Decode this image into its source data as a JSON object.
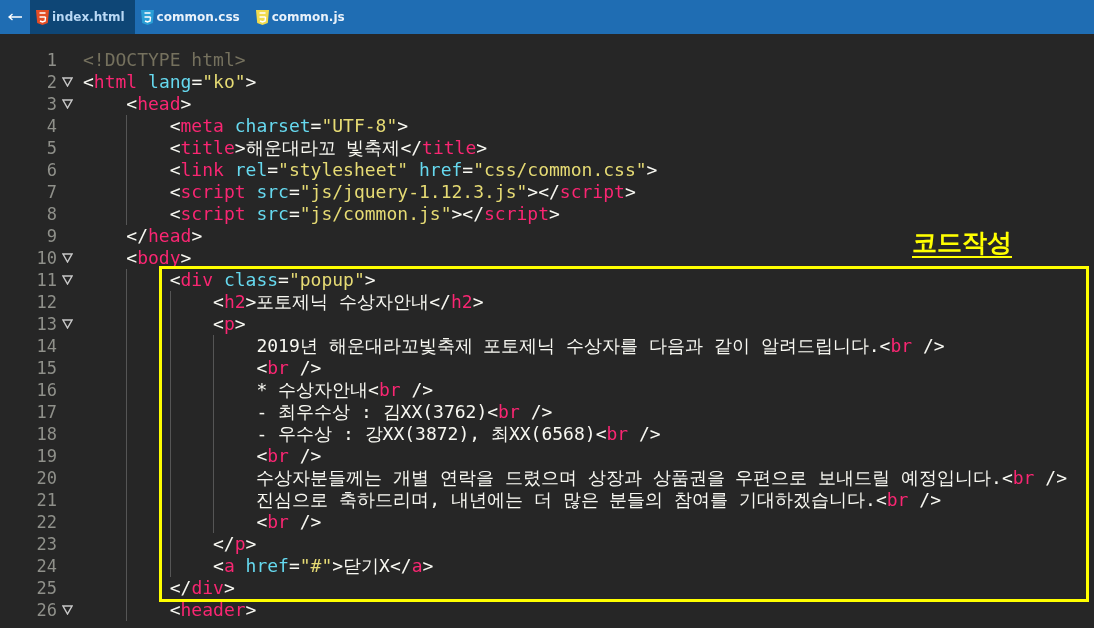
{
  "tabs": [
    {
      "label": "index.html",
      "kind": "html",
      "selected": true
    },
    {
      "label": "common.css",
      "kind": "css",
      "selected": false
    },
    {
      "label": "common.js",
      "kind": "js",
      "selected": false
    }
  ],
  "annotation": {
    "label": "코드작성"
  },
  "lines": [
    {
      "number": "1",
      "foldable": false,
      "highlighted": false,
      "tokens": [
        {
          "kind": "doctype",
          "text": "<!DOCTYPE html>"
        }
      ]
    },
    {
      "number": "2",
      "foldable": true,
      "highlighted": false,
      "tokens": [
        {
          "kind": "punct",
          "text": "<"
        },
        {
          "kind": "tag",
          "text": "html"
        },
        {
          "kind": "attr",
          "text": " lang"
        },
        {
          "kind": "punct",
          "text": "="
        },
        {
          "kind": "string",
          "text": "\"ko\""
        },
        {
          "kind": "punct",
          "text": ">"
        }
      ],
      "children": [
        {
          "number": "3",
          "foldable": true,
          "highlighted": false,
          "tokens": [
            {
              "kind": "punct",
              "text": "<"
            },
            {
              "kind": "tag",
              "text": "head"
            },
            {
              "kind": "punct",
              "text": ">"
            }
          ],
          "children": [
            {
              "number": "4",
              "foldable": false,
              "highlighted": false,
              "tokens": [
                {
                  "kind": "punct",
                  "text": "<"
                },
                {
                  "kind": "tag",
                  "text": "meta"
                },
                {
                  "kind": "attr",
                  "text": " charset"
                },
                {
                  "kind": "punct",
                  "text": "="
                },
                {
                  "kind": "string",
                  "text": "\"UTF-8\""
                },
                {
                  "kind": "punct",
                  "text": ">"
                }
              ]
            },
            {
              "number": "5",
              "foldable": false,
              "highlighted": false,
              "tokens": [
                {
                  "kind": "punct",
                  "text": "<"
                },
                {
                  "kind": "tag",
                  "text": "title"
                },
                {
                  "kind": "punct",
                  "text": ">"
                },
                {
                  "kind": "text",
                  "text": "해운대라꼬 빛축제"
                },
                {
                  "kind": "punct",
                  "text": "</"
                },
                {
                  "kind": "tag",
                  "text": "title"
                },
                {
                  "kind": "punct",
                  "text": ">"
                }
              ]
            },
            {
              "number": "6",
              "foldable": false,
              "highlighted": false,
              "tokens": [
                {
                  "kind": "punct",
                  "text": "<"
                },
                {
                  "kind": "tag",
                  "text": "link"
                },
                {
                  "kind": "attr",
                  "text": " rel"
                },
                {
                  "kind": "punct",
                  "text": "="
                },
                {
                  "kind": "string",
                  "text": "\"stylesheet\""
                },
                {
                  "kind": "attr",
                  "text": " href"
                },
                {
                  "kind": "punct",
                  "text": "="
                },
                {
                  "kind": "string",
                  "text": "\"css/common.css\""
                },
                {
                  "kind": "punct",
                  "text": ">"
                }
              ]
            },
            {
              "number": "7",
              "foldable": false,
              "highlighted": false,
              "tokens": [
                {
                  "kind": "punct",
                  "text": "<"
                },
                {
                  "kind": "tag",
                  "text": "script"
                },
                {
                  "kind": "attr",
                  "text": " src"
                },
                {
                  "kind": "punct",
                  "text": "="
                },
                {
                  "kind": "string",
                  "text": "\"js/jquery-1.12.3.js\""
                },
                {
                  "kind": "punct",
                  "text": "></"
                },
                {
                  "kind": "tag",
                  "text": "script"
                },
                {
                  "kind": "punct",
                  "text": ">"
                }
              ]
            },
            {
              "number": "8",
              "foldable": false,
              "highlighted": false,
              "tokens": [
                {
                  "kind": "punct",
                  "text": "<"
                },
                {
                  "kind": "tag",
                  "text": "script"
                },
                {
                  "kind": "attr",
                  "text": " src"
                },
                {
                  "kind": "punct",
                  "text": "="
                },
                {
                  "kind": "string",
                  "text": "\"js/common.js\""
                },
                {
                  "kind": "punct",
                  "text": "></"
                },
                {
                  "kind": "tag",
                  "text": "script"
                },
                {
                  "kind": "punct",
                  "text": ">"
                }
              ]
            }
          ]
        },
        {
          "number": "9",
          "foldable": false,
          "highlighted": false,
          "tokens": [
            {
              "kind": "punct",
              "text": "</"
            },
            {
              "kind": "tag",
              "text": "head"
            },
            {
              "kind": "punct",
              "text": ">"
            }
          ]
        },
        {
          "number": "10",
          "foldable": true,
          "highlighted": false,
          "tokens": [
            {
              "kind": "punct",
              "text": "<"
            },
            {
              "kind": "tag",
              "text": "body"
            },
            {
              "kind": "punct",
              "text": ">"
            }
          ],
          "children": [
            {
              "number": "11",
              "foldable": true,
              "highlighted": true,
              "tokens": [
                {
                  "kind": "punct",
                  "text": "<"
                },
                {
                  "kind": "tag",
                  "text": "div"
                },
                {
                  "kind": "attr",
                  "text": " class"
                },
                {
                  "kind": "punct",
                  "text": "="
                },
                {
                  "kind": "string",
                  "text": "\"popup\""
                },
                {
                  "kind": "punct",
                  "text": ">"
                }
              ],
              "children": [
                {
                  "number": "12",
                  "foldable": false,
                  "highlighted": true,
                  "tokens": [
                    {
                      "kind": "punct",
                      "text": "<"
                    },
                    {
                      "kind": "tag",
                      "text": "h2"
                    },
                    {
                      "kind": "punct",
                      "text": ">"
                    },
                    {
                      "kind": "text",
                      "text": "포토제닉 수상자안내"
                    },
                    {
                      "kind": "punct",
                      "text": "</"
                    },
                    {
                      "kind": "tag",
                      "text": "h2"
                    },
                    {
                      "kind": "punct",
                      "text": ">"
                    }
                  ]
                },
                {
                  "number": "13",
                  "foldable": true,
                  "highlighted": true,
                  "tokens": [
                    {
                      "kind": "punct",
                      "text": "<"
                    },
                    {
                      "kind": "tag",
                      "text": "p"
                    },
                    {
                      "kind": "punct",
                      "text": ">"
                    }
                  ],
                  "children": [
                    {
                      "number": "14",
                      "foldable": false,
                      "highlighted": true,
                      "tokens": [
                        {
                          "kind": "text",
                          "text": "2019년 해운대라꼬빛축제 포토제닉 수상자를 다음과 같이 알려드립니다."
                        },
                        {
                          "kind": "punct",
                          "text": "<"
                        },
                        {
                          "kind": "tag",
                          "text": "br"
                        },
                        {
                          "kind": "punct",
                          "text": " />"
                        }
                      ]
                    },
                    {
                      "number": "15",
                      "foldable": false,
                      "highlighted": true,
                      "tokens": [
                        {
                          "kind": "punct",
                          "text": "<"
                        },
                        {
                          "kind": "tag",
                          "text": "br"
                        },
                        {
                          "kind": "punct",
                          "text": " />"
                        }
                      ]
                    },
                    {
                      "number": "16",
                      "foldable": false,
                      "highlighted": true,
                      "tokens": [
                        {
                          "kind": "text",
                          "text": "* 수상자안내"
                        },
                        {
                          "kind": "punct",
                          "text": "<"
                        },
                        {
                          "kind": "tag",
                          "text": "br"
                        },
                        {
                          "kind": "punct",
                          "text": " />"
                        }
                      ]
                    },
                    {
                      "number": "17",
                      "foldable": false,
                      "highlighted": true,
                      "tokens": [
                        {
                          "kind": "text",
                          "text": "- 최우수상 : 김XX(3762)"
                        },
                        {
                          "kind": "punct",
                          "text": "<"
                        },
                        {
                          "kind": "tag",
                          "text": "br"
                        },
                        {
                          "kind": "punct",
                          "text": " />"
                        }
                      ]
                    },
                    {
                      "number": "18",
                      "foldable": false,
                      "highlighted": true,
                      "tokens": [
                        {
                          "kind": "text",
                          "text": "- 우수상 : 강XX(3872), 최XX(6568)"
                        },
                        {
                          "kind": "punct",
                          "text": "<"
                        },
                        {
                          "kind": "tag",
                          "text": "br"
                        },
                        {
                          "kind": "punct",
                          "text": " />"
                        }
                      ]
                    },
                    {
                      "number": "19",
                      "foldable": false,
                      "highlighted": true,
                      "tokens": [
                        {
                          "kind": "punct",
                          "text": "<"
                        },
                        {
                          "kind": "tag",
                          "text": "br"
                        },
                        {
                          "kind": "punct",
                          "text": " />"
                        }
                      ]
                    },
                    {
                      "number": "20",
                      "foldable": false,
                      "highlighted": true,
                      "tokens": [
                        {
                          "kind": "text",
                          "text": "수상자분들께는 개별 연락을 드렸으며 상장과 상품권을 우편으로 보내드릴 예정입니다."
                        },
                        {
                          "kind": "punct",
                          "text": "<"
                        },
                        {
                          "kind": "tag",
                          "text": "br"
                        },
                        {
                          "kind": "punct",
                          "text": " />"
                        }
                      ]
                    },
                    {
                      "number": "21",
                      "foldable": false,
                      "highlighted": true,
                      "tokens": [
                        {
                          "kind": "text",
                          "text": "진심으로 축하드리며, 내년에는 더 많은 분들의 참여를 기대하겠습니다."
                        },
                        {
                          "kind": "punct",
                          "text": "<"
                        },
                        {
                          "kind": "tag",
                          "text": "br"
                        },
                        {
                          "kind": "punct",
                          "text": " />"
                        }
                      ]
                    },
                    {
                      "number": "22",
                      "foldable": false,
                      "highlighted": true,
                      "tokens": [
                        {
                          "kind": "punct",
                          "text": "<"
                        },
                        {
                          "kind": "tag",
                          "text": "br"
                        },
                        {
                          "kind": "punct",
                          "text": " />"
                        }
                      ]
                    }
                  ]
                },
                {
                  "number": "23",
                  "foldable": false,
                  "highlighted": true,
                  "tokens": [
                    {
                      "kind": "punct",
                      "text": "</"
                    },
                    {
                      "kind": "tag",
                      "text": "p"
                    },
                    {
                      "kind": "punct",
                      "text": ">"
                    }
                  ]
                },
                {
                  "number": "24",
                  "foldable": false,
                  "highlighted": true,
                  "tokens": [
                    {
                      "kind": "punct",
                      "text": "<"
                    },
                    {
                      "kind": "tag",
                      "text": "a"
                    },
                    {
                      "kind": "attr",
                      "text": " href"
                    },
                    {
                      "kind": "punct",
                      "text": "="
                    },
                    {
                      "kind": "string",
                      "text": "\"#\""
                    },
                    {
                      "kind": "punct",
                      "text": ">"
                    },
                    {
                      "kind": "text",
                      "text": "닫기X"
                    },
                    {
                      "kind": "punct",
                      "text": "</"
                    },
                    {
                      "kind": "tag",
                      "text": "a"
                    },
                    {
                      "kind": "punct",
                      "text": ">"
                    }
                  ]
                }
              ]
            },
            {
              "number": "25",
              "foldable": false,
              "highlighted": true,
              "tokens": [
                {
                  "kind": "punct",
                  "text": "</"
                },
                {
                  "kind": "tag",
                  "text": "div"
                },
                {
                  "kind": "punct",
                  "text": ">"
                }
              ]
            },
            {
              "number": "26",
              "foldable": true,
              "highlighted": false,
              "tokens": [
                {
                  "kind": "punct",
                  "text": "<"
                },
                {
                  "kind": "tag",
                  "text": "header"
                },
                {
                  "kind": "punct",
                  "text": ">"
                }
              ]
            }
          ]
        }
      ]
    }
  ]
}
